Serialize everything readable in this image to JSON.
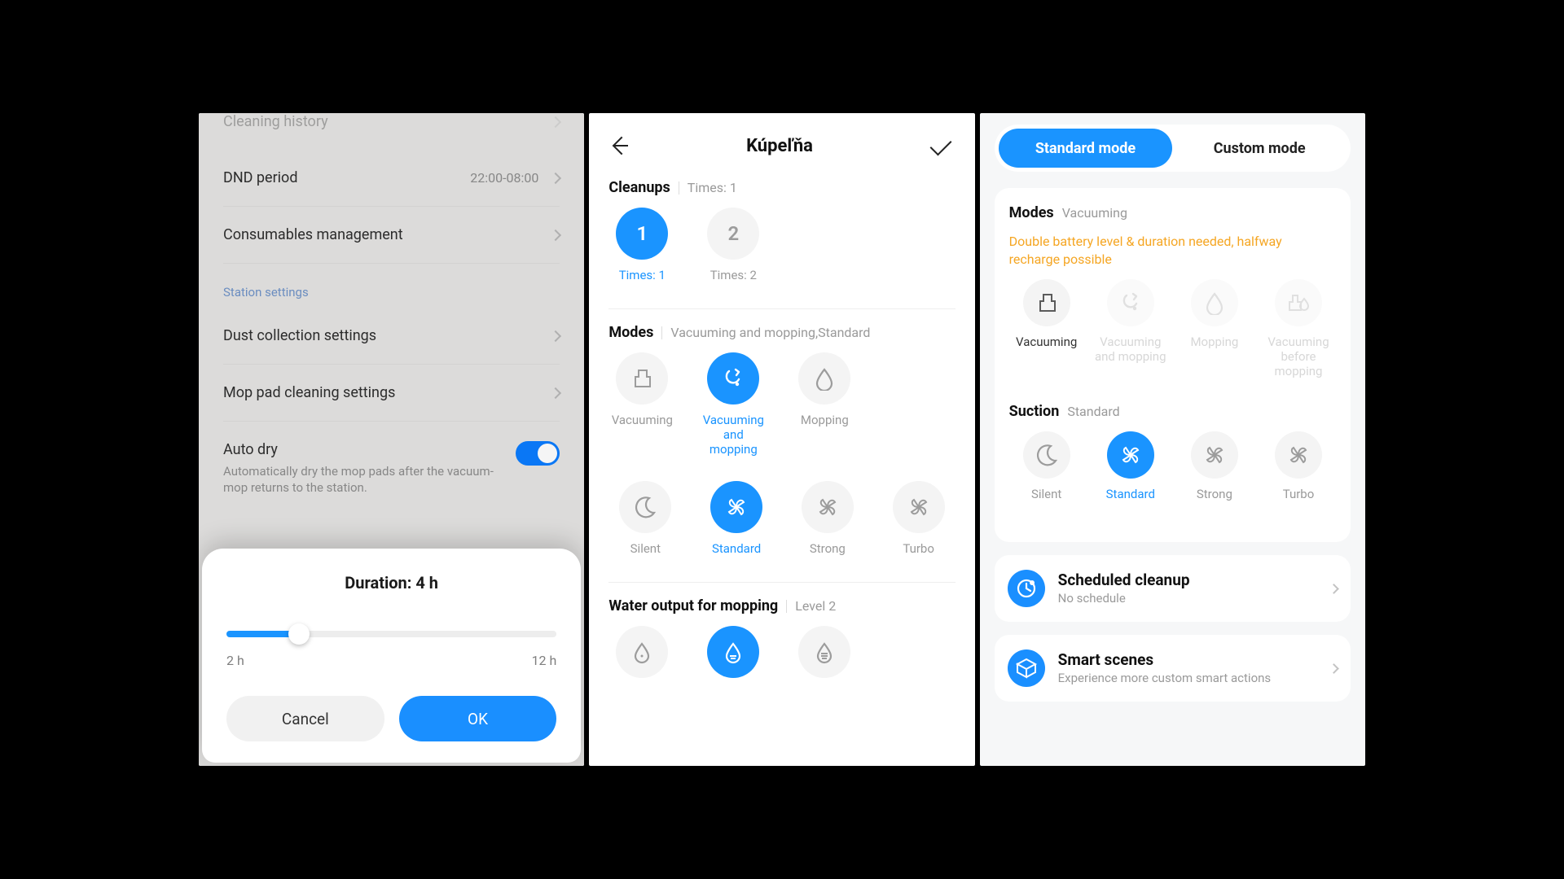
{
  "p1": {
    "cut_row": "Cleaning history",
    "dnd": {
      "label": "DND period",
      "value": "22:00-08:00"
    },
    "consumables": "Consumables management",
    "station_header": "Station settings",
    "dust": "Dust collection settings",
    "mop": "Mop pad cleaning settings",
    "auto_dry": {
      "title": "Auto dry",
      "sub": "Automatically dry the mop pads after the vacuum-mop returns to the station."
    },
    "sheet": {
      "title": "Duration: 4 h",
      "min": "2 h",
      "max": "12 h",
      "cancel": "Cancel",
      "ok": "OK"
    }
  },
  "p2": {
    "title": "Kúpeľňa",
    "cleanups": {
      "label": "Cleanups",
      "current": "Times: 1",
      "opts": [
        {
          "num": "1",
          "label": "Times: 1",
          "sel": true
        },
        {
          "num": "2",
          "label": "Times: 2",
          "sel": false
        }
      ]
    },
    "modes": {
      "label": "Modes",
      "current": "Vacuuming and mopping,Standard",
      "opts": [
        {
          "name": "Vacuuming",
          "sel": false,
          "icon": "vac"
        },
        {
          "name": "Vacuuming and mopping",
          "sel": true,
          "icon": "vacmop"
        },
        {
          "name": "Mopping",
          "sel": false,
          "icon": "drop"
        }
      ]
    },
    "suction": {
      "opts": [
        {
          "name": "Silent",
          "icon": "moon"
        },
        {
          "name": "Standard",
          "icon": "fan",
          "sel": true
        },
        {
          "name": "Strong",
          "icon": "fan"
        },
        {
          "name": "Turbo",
          "icon": "fan"
        }
      ]
    },
    "water": {
      "label": "Water output for mopping",
      "current": "Level 2",
      "opts": [
        {
          "icon": "drop1"
        },
        {
          "icon": "drop2",
          "sel": true
        },
        {
          "icon": "drop3"
        }
      ]
    }
  },
  "p3": {
    "seg": {
      "standard": "Standard mode",
      "custom": "Custom mode"
    },
    "modes": {
      "label": "Modes",
      "current": "Vacuuming",
      "warn": "Double battery level & duration needed, halfway recharge possible",
      "opts": [
        {
          "name": "Vacuuming",
          "icon": "vac",
          "state": "active-dark"
        },
        {
          "name": "Vacuuming and mopping",
          "icon": "vacmop",
          "state": "dis"
        },
        {
          "name": "Mopping",
          "icon": "drop",
          "state": "dis"
        },
        {
          "name": "Vacuuming before mopping",
          "icon": "vacmop2",
          "state": "dis"
        }
      ]
    },
    "suction": {
      "label": "Suction",
      "current": "Standard",
      "opts": [
        {
          "name": "Silent",
          "icon": "moon"
        },
        {
          "name": "Standard",
          "icon": "fan",
          "sel": true
        },
        {
          "name": "Strong",
          "icon": "fan"
        },
        {
          "name": "Turbo",
          "icon": "fan"
        }
      ]
    },
    "scheduled": {
      "title": "Scheduled cleanup",
      "sub": "No schedule"
    },
    "scenes": {
      "title": "Smart scenes",
      "sub": "Experience more custom smart actions"
    }
  }
}
